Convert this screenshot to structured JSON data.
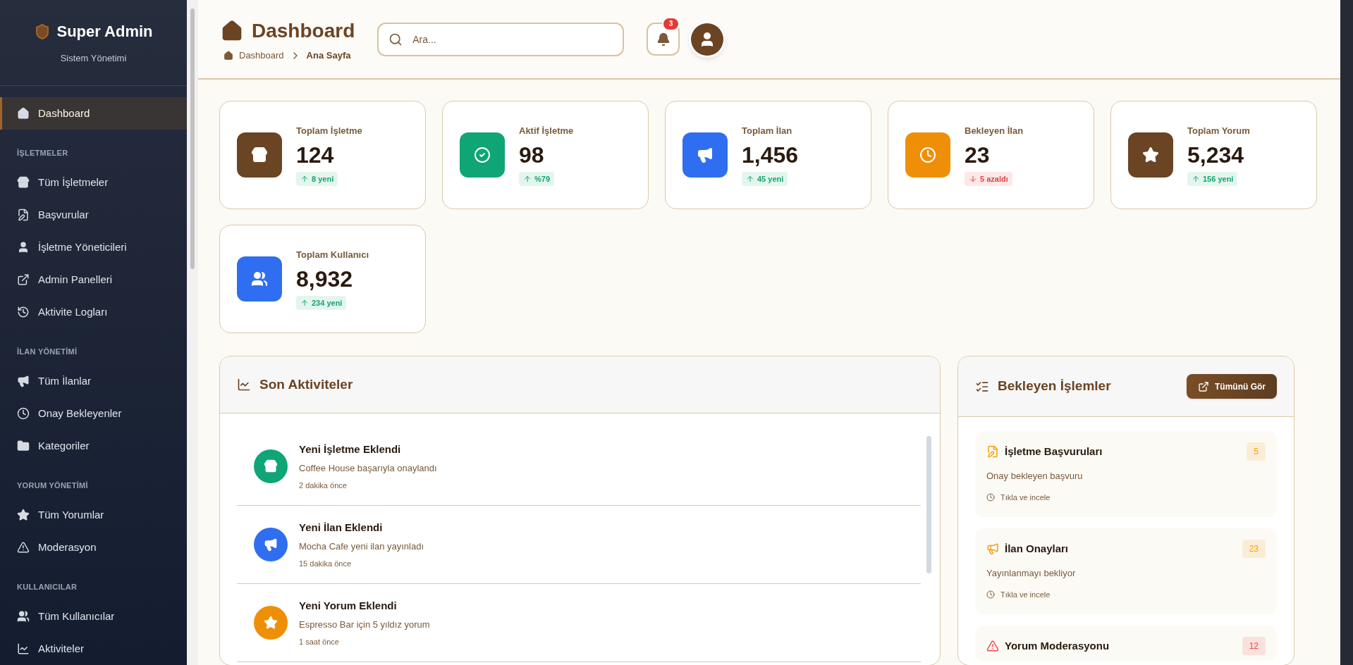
{
  "sidebar": {
    "brand": "Super Admin",
    "subtitle": "Sistem Yönetimi",
    "items": [
      {
        "kind": "link",
        "label": "Dashboard",
        "selected": true
      },
      {
        "kind": "section",
        "label": "İŞLETMELER"
      },
      {
        "kind": "link",
        "label": "Tüm İşletmeler",
        "selected": false
      },
      {
        "kind": "link",
        "label": "Başvurular",
        "selected": false
      },
      {
        "kind": "link",
        "label": "İşletme Yöneticileri",
        "selected": false
      },
      {
        "kind": "link",
        "label": "Admin Panelleri",
        "selected": false
      },
      {
        "kind": "link",
        "label": "Aktivite Logları",
        "selected": false
      },
      {
        "kind": "section",
        "label": "İLAN YÖNETİMİ"
      },
      {
        "kind": "link",
        "label": "Tüm İlanlar",
        "selected": false
      },
      {
        "kind": "link",
        "label": "Onay Bekleyenler",
        "selected": false
      },
      {
        "kind": "link",
        "label": "Kategoriler",
        "selected": false
      },
      {
        "kind": "section",
        "label": "YORUM YÖNETİMİ"
      },
      {
        "kind": "link",
        "label": "Tüm Yorumlar",
        "selected": false
      },
      {
        "kind": "link",
        "label": "Moderasyon",
        "selected": false
      },
      {
        "kind": "section",
        "label": "KULLANICILAR"
      },
      {
        "kind": "link",
        "label": "Tüm Kullanıcılar",
        "selected": false
      },
      {
        "kind": "link",
        "label": "Aktiviteler",
        "selected": false
      }
    ]
  },
  "header": {
    "title": "Dashboard",
    "breadcrumb": [
      "Dashboard",
      "Ana Sayfa"
    ],
    "search": {
      "placeholder": "Ara..."
    },
    "notifications": "3"
  },
  "stats": [
    {
      "label": "Toplam İşletme",
      "value": "124",
      "down": false,
      "change": "8 yeni",
      "color": "#6b4423"
    },
    {
      "label": "Aktif İşletme",
      "value": "98",
      "down": false,
      "change": "%79",
      "color": "#10a574"
    },
    {
      "label": "Toplam İlan",
      "value": "1,456",
      "down": false,
      "change": "45 yeni",
      "color": "#2f6ef0"
    },
    {
      "label": "Bekleyen İlan",
      "value": "23",
      "down": true,
      "change": "5 azaldı",
      "color": "#ef8f08"
    },
    {
      "label": "Toplam Yorum",
      "value": "5,234",
      "down": false,
      "change": "156 yeni",
      "color": "#6b4423"
    },
    {
      "label": "Toplam Kullanıcı",
      "value": "8,932",
      "down": false,
      "change": "234 yeni",
      "color": "#2f6ef0"
    }
  ],
  "activities": {
    "title": "Son Aktiviteler",
    "items": [
      {
        "title": "Yeni İşletme Eklendi",
        "text": "Coffee House başarıyla onaylandı",
        "time": "2 dakika önce",
        "color": "#10a574"
      },
      {
        "title": "Yeni İlan Eklendi",
        "text": "Mocha Cafe yeni ilan yayınladı",
        "time": "15 dakika önce",
        "color": "#2f6ef0"
      },
      {
        "title": "Yeni Yorum Eklendi",
        "text": "Espresso Bar için 5 yıldız yorum",
        "time": "1 saat önce",
        "color": "#ef8f08"
      }
    ]
  },
  "pending": {
    "title": "Bekleyen İşlemler",
    "button": "Tümünü Gör",
    "items": [
      {
        "title": "İşletme Başvuruları",
        "text": "Onay bekleyen başvuru",
        "hint": "Tıkla ve incele",
        "count": "5",
        "color": "#f59e0b"
      },
      {
        "title": "İlan Onayları",
        "text": "Yayınlanmayı bekliyor",
        "hint": "Tıkla ve incele",
        "count": "23",
        "color": "#f59e0b"
      },
      {
        "title": "Yorum Moderasyonu",
        "count": "12",
        "color": "#ef4444"
      }
    ]
  }
}
